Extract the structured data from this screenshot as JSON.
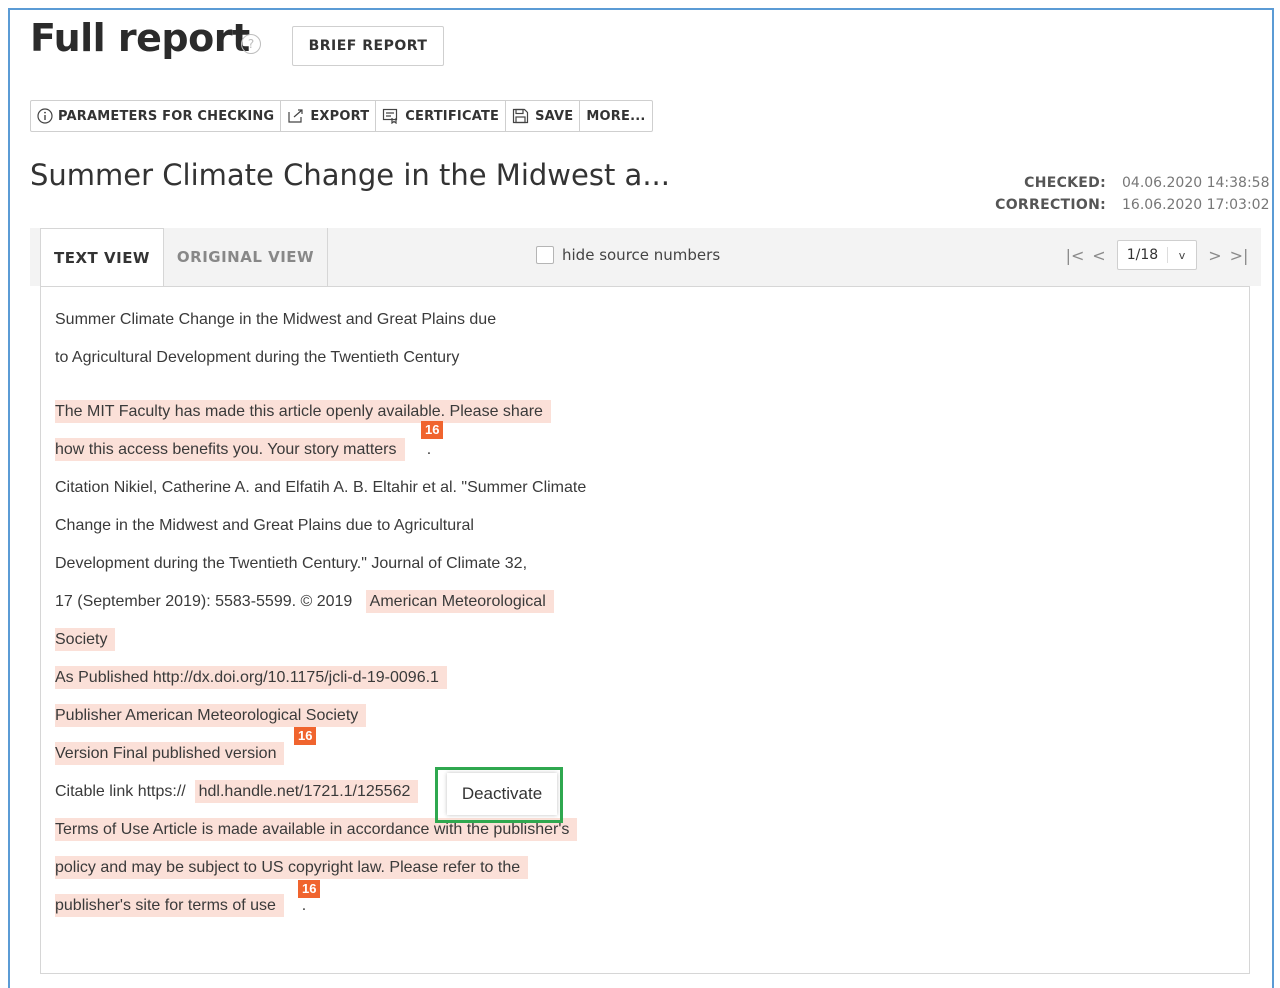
{
  "header": {
    "title": "Full report",
    "help_glyph": "?",
    "brief_report": "BRIEF REPORT"
  },
  "toolbar": {
    "params": "PARAMETERS FOR CHECKING",
    "export": "EXPORT",
    "certificate": "CERTIFICATE",
    "save": "SAVE",
    "more": "MORE..."
  },
  "document": {
    "title": "Summer Climate Change in the Midwest a...",
    "checked_label": "CHECKED:",
    "checked_value": "04.06.2020 14:38:58",
    "correction_label": "CORRECTION:",
    "correction_value": "16.06.2020 17:03:02"
  },
  "tabs": {
    "text_view": "TEXT VIEW",
    "original_view": "ORIGINAL VIEW",
    "hide_source_numbers": "hide source numbers"
  },
  "pager": {
    "value": "1/18",
    "first_glyph": "|<",
    "prev_glyph": "<",
    "next_glyph": ">",
    "last_glyph": ">|",
    "dropdown_glyph": "v"
  },
  "text": {
    "l1": "Summer Climate Change in the Midwest and Great Plains due",
    "l2": "to Agricultural Development during the Twentieth Century",
    "l3": "The MIT Faculty has made this article openly available. Please share",
    "l4": "how this access benefits you. Your story matters",
    "l4_tail": ".",
    "l5": "Citation Nikiel, Catherine A. and Elfatih A. B. Eltahir et al. \"Summer Climate",
    "l6": "Change in the Midwest and Great Plains due to Agricultural",
    "l7": "Development during the Twentieth Century.\" Journal of Climate 32,",
    "l8": "17 (September 2019): 5583-5599. © 2019",
    "l8_hl": "American Meteorological",
    "l9": "Society",
    "l10": "As Published http://dx.doi.org/10.1175/jcli-d-19-0096.1",
    "l11": "Publisher American Meteorological Society",
    "l12": "Version Final published version",
    "l13": "Citable link https://",
    "l13_hl": "hdl.handle.net/1721.1/125562",
    "l14": "Terms of Use Article is made available in accordance with the publisher's",
    "l15": "policy and may be subject to US copyright law. Please refer to the",
    "l16": "publisher's site for terms of use",
    "l16_tail": "."
  },
  "badges": {
    "b1": "16",
    "b2": "16",
    "b3": "16"
  },
  "popup": {
    "deactivate": "Deactivate"
  },
  "colors": {
    "highlight": "#fbe0d8",
    "badge": "#f0642e",
    "deactivate_outline": "#2fa84f",
    "frame": "#5b9bd5"
  }
}
